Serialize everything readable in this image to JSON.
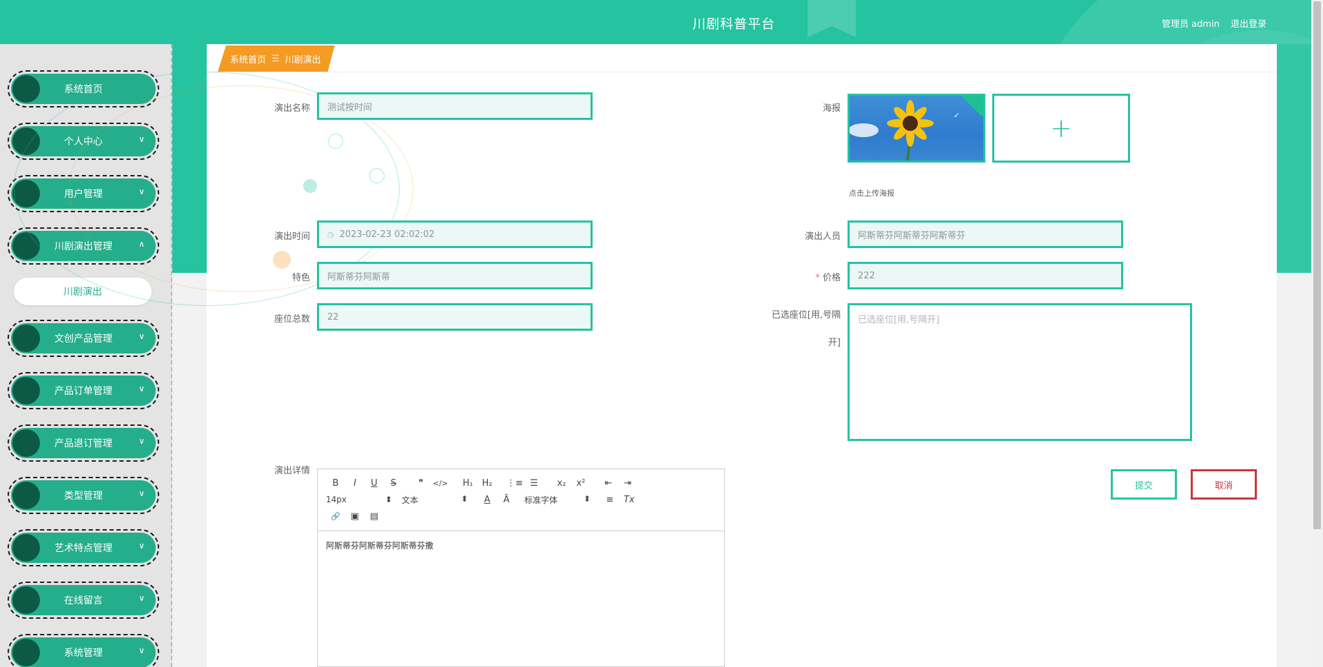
{
  "header": {
    "title": "川剧科普平台",
    "user_label": "管理员 admin",
    "logout": "退出登录"
  },
  "sidebar": {
    "items": [
      {
        "label": "系统首页",
        "chevron": ""
      },
      {
        "label": "个人中心",
        "chevron": "∨"
      },
      {
        "label": "用户管理",
        "chevron": "∨"
      },
      {
        "label": "川剧演出管理",
        "chevron": "∧"
      },
      {
        "label": "文创产品管理",
        "chevron": "∨"
      },
      {
        "label": "产品订单管理",
        "chevron": "∨"
      },
      {
        "label": "产品退订管理",
        "chevron": "∨"
      },
      {
        "label": "类型管理",
        "chevron": "∨"
      },
      {
        "label": "艺术特点管理",
        "chevron": "∨"
      },
      {
        "label": "在线留言",
        "chevron": "∨"
      },
      {
        "label": "系统管理",
        "chevron": "∨"
      }
    ],
    "sub_item": "川剧演出"
  },
  "breadcrumb": {
    "home": "系统首页",
    "separator": "☰",
    "current": "川剧演出"
  },
  "form": {
    "name_label": "演出名称",
    "name_value": "测试按时间",
    "poster_label": "海报",
    "poster_hint": "点击上传海报",
    "upload_plus": "+",
    "poster_check": "✓",
    "time_label": "演出时间",
    "time_icon": "◷",
    "time_value": "2023-02-23 02:02:02",
    "performer_label": "演出人员",
    "performer_value": "阿斯蒂芬阿斯蒂芬阿斯蒂芬",
    "feature_label": "特色",
    "feature_value": "阿斯蒂芬阿斯蒂",
    "price_required": "*",
    "price_label": "价格",
    "price_value": "222",
    "seats_label": "座位总数",
    "seats_value": "22",
    "selected_label_1": "已选座位[用,号隔",
    "selected_label_2": "开]",
    "selected_placeholder": "已选座位[用,号隔开]",
    "detail_label": "演出详情",
    "detail_value": "阿斯蒂芬阿斯蒂芬阿斯蒂芬撒"
  },
  "editor": {
    "row1": [
      "B",
      "I",
      "U",
      "S",
      "❞",
      "</>",
      "H₁",
      "H₂",
      "⋮≡",
      "☰",
      "x₂",
      "x²",
      "⇤",
      "⇥"
    ],
    "font_size": "14px",
    "text_type": "文本",
    "font_family": "标准字体",
    "select_arrow": "⬍",
    "row2_icons": [
      "A",
      "Ã",
      "≡",
      "Tx"
    ],
    "row3_icons": [
      "🔗",
      "▣",
      "▤"
    ]
  },
  "buttons": {
    "submit": "提交",
    "cancel": "取消"
  },
  "colors": {
    "primary": "#25c3a0",
    "sidebar_pill": "#25ae8b",
    "breadcrumb": "#f59a22",
    "cancel": "#c8353e"
  }
}
